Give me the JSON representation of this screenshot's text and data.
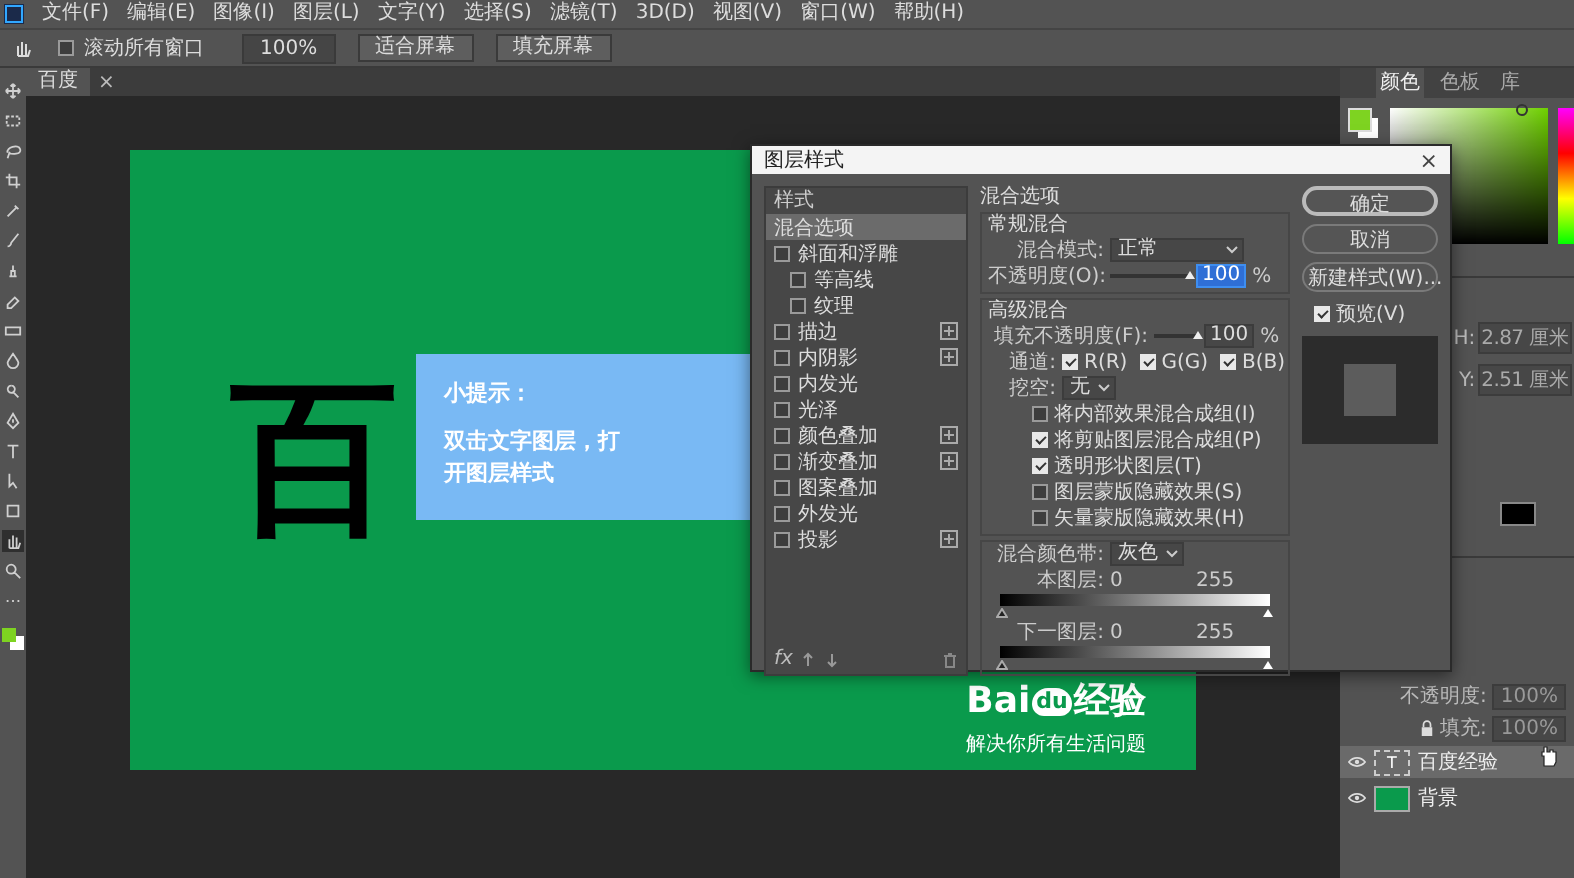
{
  "menu_bar": [
    "文件(F)",
    "编辑(E)",
    "图像(I)",
    "图层(L)",
    "文字(Y)",
    "选择(S)",
    "滤镜(T)",
    "3D(D)",
    "视图(V)",
    "窗口(W)",
    "帮助(H)"
  ],
  "options_bar": {
    "scroll_all": {
      "label": "滚动所有窗口",
      "checked": false
    },
    "zoom": "100%",
    "buttons": [
      "适合屏幕",
      "填充屏幕"
    ]
  },
  "document_tab": {
    "label": "百度",
    "close": "×",
    "selected": true
  },
  "toolbar": {
    "tools": [
      {
        "kind": "move",
        "selected": false
      },
      {
        "kind": "marquee",
        "selected": false
      },
      {
        "kind": "lasso",
        "selected": false
      },
      {
        "kind": "crop",
        "selected": false
      },
      {
        "kind": "eyedropper",
        "selected": false
      },
      {
        "kind": "brush",
        "selected": false
      },
      {
        "kind": "stamp",
        "selected": false
      },
      {
        "kind": "eraser",
        "selected": false
      },
      {
        "kind": "gradient",
        "selected": false
      },
      {
        "kind": "blur",
        "selected": false
      },
      {
        "kind": "dodge",
        "selected": false
      },
      {
        "kind": "pen",
        "selected": false
      },
      {
        "kind": "type",
        "selected": false
      },
      {
        "kind": "path",
        "selected": false
      },
      {
        "kind": "shape",
        "selected": false
      },
      {
        "kind": "hand",
        "selected": true
      },
      {
        "kind": "zoom",
        "selected": false
      },
      {
        "kind": "more",
        "selected": false
      }
    ],
    "swatches": true
  },
  "canvas": {
    "heading": "百",
    "tip": {
      "title": "小提示：",
      "body": "双击文字图层，打开图层样式"
    },
    "logo": {
      "part_1": "Bai",
      "part_2": "du",
      "part_3": "经验"
    },
    "tagline": "解决你所有生活问题"
  },
  "dialog": {
    "title": "图层样式",
    "close": "×",
    "styles_header": "样式",
    "styles": [
      {
        "label": "混合选项",
        "kind": "plain",
        "selected": true
      },
      {
        "label": "斜面和浮雕",
        "kind": "check",
        "checked": false,
        "selected": false,
        "has_add": false,
        "children": [
          {
            "label": "等高线",
            "kind": "check",
            "checked": false,
            "selected": false,
            "has_add": false
          },
          {
            "label": "纹理",
            "kind": "check",
            "checked": false,
            "selected": false,
            "has_add": false
          }
        ]
      },
      {
        "label": "描边",
        "kind": "check",
        "checked": false,
        "selected": false,
        "has_add": true
      },
      {
        "label": "内阴影",
        "kind": "check",
        "checked": false,
        "selected": false,
        "has_add": true
      },
      {
        "label": "内发光",
        "kind": "check",
        "checked": false,
        "selected": false,
        "has_add": false
      },
      {
        "label": "光泽",
        "kind": "check",
        "checked": false,
        "selected": false,
        "has_add": false
      },
      {
        "label": "颜色叠加",
        "kind": "check",
        "checked": false,
        "selected": false,
        "has_add": true
      },
      {
        "label": "渐变叠加",
        "kind": "check",
        "checked": false,
        "selected": false,
        "has_add": true
      },
      {
        "label": "图案叠加",
        "kind": "check",
        "checked": false,
        "selected": false,
        "has_add": false
      },
      {
        "label": "外发光",
        "kind": "check",
        "checked": false,
        "selected": false,
        "has_add": false
      },
      {
        "label": "投影",
        "kind": "check",
        "checked": false,
        "selected": false,
        "has_add": true
      }
    ],
    "fx": "fx",
    "blending": {
      "title": "混合选项",
      "general": {
        "title": "常规混合",
        "mode_label": "混合模式:",
        "mode": "正常",
        "opacity_label": "不透明度(O):",
        "opacity": {
          "level": 1
        },
        "opacity_value": "100",
        "unit": "%"
      },
      "advanced": {
        "title": "高级混合",
        "fill_label": "填充不透明度(F):",
        "fill": {
          "level": 1
        },
        "fill_value": "100",
        "unit": "%",
        "channels_label": "通道:",
        "channels": [
          {
            "label": "R(R)",
            "checked": true
          },
          {
            "label": "G(G)",
            "checked": true
          },
          {
            "label": "B(B)",
            "checked": true
          }
        ],
        "knockout_label": "挖空:",
        "knockout": "无",
        "options": [
          {
            "label": "将内部效果混合成组(I)",
            "checked": false
          },
          {
            "label": "将剪贴图层混合成组(P)",
            "checked": true
          },
          {
            "label": "透明形状图层(T)",
            "checked": true
          },
          {
            "label": "图层蒙版隐藏效果(S)",
            "checked": false
          },
          {
            "label": "矢量蒙版隐藏效果(H)",
            "checked": false
          }
        ]
      },
      "blend_if": {
        "label": "混合颜色带:",
        "value": "灰色",
        "bands": [
          {
            "label": "本图层:",
            "low": "0",
            "high": "255"
          },
          {
            "label": "下一图层:",
            "low": "0",
            "high": "255"
          }
        ]
      }
    },
    "buttons": [
      {
        "label": "确定",
        "default": true
      },
      {
        "label": "取消",
        "default": false
      },
      {
        "label": "新建样式(W)...",
        "default": false
      }
    ],
    "preview": {
      "label": "预览(V)",
      "checked": true
    }
  },
  "color_panel": {
    "tabs": [
      {
        "label": "颜色",
        "selected": true
      },
      {
        "label": "色板",
        "selected": false
      },
      {
        "label": "库",
        "selected": false
      }
    ]
  },
  "properties": {
    "fields": [
      {
        "label": "H:",
        "value": "2.87 厘米"
      },
      {
        "label": "Y:",
        "value": "2.51 厘米"
      }
    ]
  },
  "layers": {
    "opacity_label": "不透明度:",
    "opacity": "100%",
    "fill_label": "填充:",
    "fill": "100%",
    "items": [
      {
        "name": "百度经验",
        "kind": "text",
        "thumb_label": "T",
        "visible": true,
        "selected": true
      },
      {
        "name": "背景",
        "kind": "image",
        "visible": true,
        "selected": false
      }
    ]
  }
}
